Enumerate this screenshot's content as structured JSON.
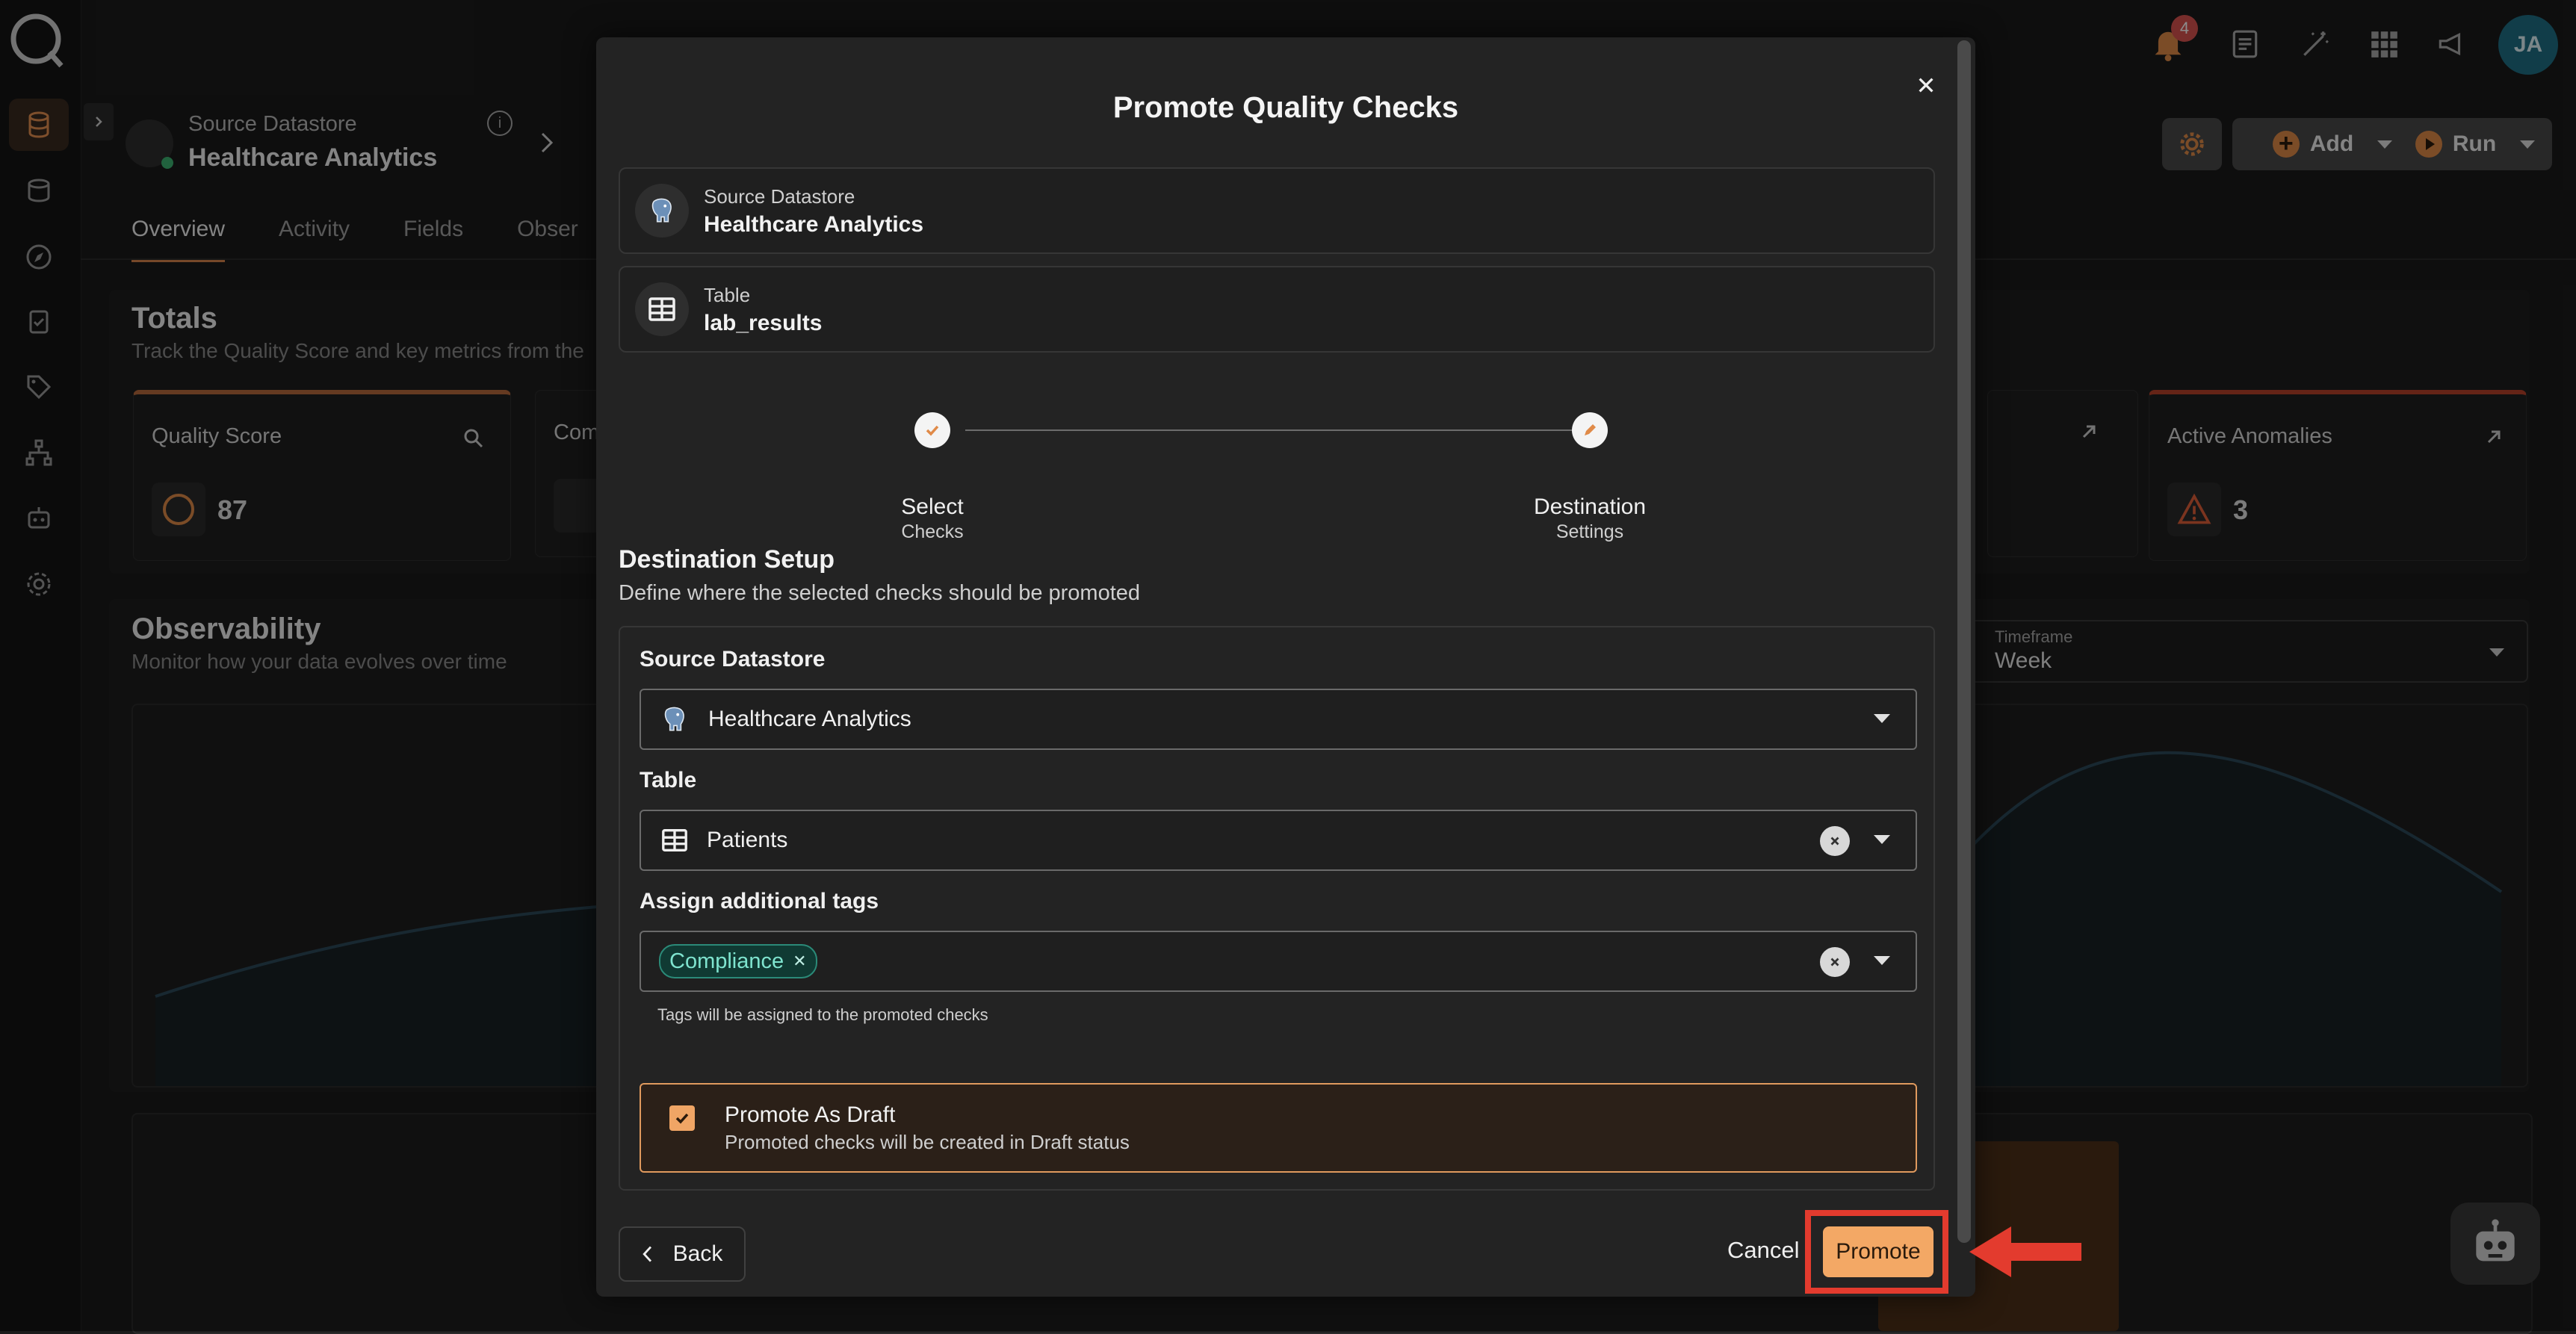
{
  "header": {
    "source_label": "Source Datastore",
    "source_name": "Healthcare Analytics",
    "notifications_count": "4",
    "user_initials": "JA",
    "add_label": "Add",
    "run_label": "Run"
  },
  "tabs": [
    "Overview",
    "Activity",
    "Fields",
    "Obser"
  ],
  "totals": {
    "title": "Totals",
    "subtitle": "Track the Quality Score and key metrics from the",
    "quality_score_label": "Quality Score",
    "quality_score_value": "87",
    "second_card_label": "Com",
    "active_anomalies_label": "Active Anomalies",
    "active_anomalies_value": "3"
  },
  "observability": {
    "title": "Observability",
    "subtitle": "Monitor how your data evolves over time",
    "timeframe_label": "Timeframe",
    "timeframe_value": "Week"
  },
  "modal": {
    "title": "Promote Quality Checks",
    "source_label": "Source Datastore",
    "source_value": "Healthcare Analytics",
    "table_label": "Table",
    "table_value": "lab_results",
    "steps": [
      {
        "line1": "Select",
        "line2": "Checks"
      },
      {
        "line1": "Destination",
        "line2": "Settings"
      }
    ],
    "setup_title": "Destination Setup",
    "setup_subtitle": "Define where the selected checks should be promoted",
    "fields": {
      "source_datastore_label": "Source Datastore",
      "source_datastore_value": "Healthcare Analytics",
      "table_label": "Table",
      "table_value": "Patients",
      "tags_label": "Assign additional tags",
      "tag_chip": "Compliance",
      "tags_helper": "Tags will be assigned to the promoted checks"
    },
    "draft": {
      "title": "Promote As Draft",
      "subtitle": "Promoted checks will be created in Draft status",
      "checked": true
    },
    "back_label": "Back",
    "cancel_label": "Cancel",
    "promote_label": "Promote"
  },
  "colors": {
    "accent": "#f3a865",
    "highlight": "#e33b2e",
    "chip": "#2b8a78"
  }
}
